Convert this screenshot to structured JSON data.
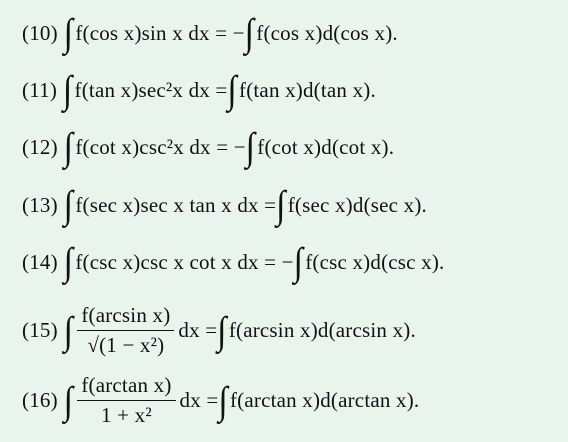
{
  "formulas": [
    {
      "number": "(10)",
      "left": "f(cos x)sin x dx = −",
      "right": "f(cos x)d(cos x)."
    },
    {
      "number": "(11)",
      "left": "f(tan x)sec²x dx =",
      "right": "f(tan x)d(tan x)."
    },
    {
      "number": "(12)",
      "left": "f(cot x)csc²x dx = −",
      "right": "f(cot x)d(cot x)."
    },
    {
      "number": "(13)",
      "left": "f(sec x)sec x tan x dx =",
      "right": "f(sec x)d(sec x)."
    },
    {
      "number": "(14)",
      "left": "f(csc x)csc x cot x dx = −",
      "right": "f(csc x)d(csc x)."
    },
    {
      "number": "(15)",
      "numerator": "f(arcsin x)",
      "denominator": "√(1 − x²)",
      "middle": "dx =",
      "right": "f(arcsin x)d(arcsin x)."
    },
    {
      "number": "(16)",
      "numerator": "f(arctan x)",
      "denominator": "1 + x²",
      "middle": "dx =",
      "right": "f(arctan x)d(arctan x)."
    }
  ],
  "integral_symbol": "∫"
}
